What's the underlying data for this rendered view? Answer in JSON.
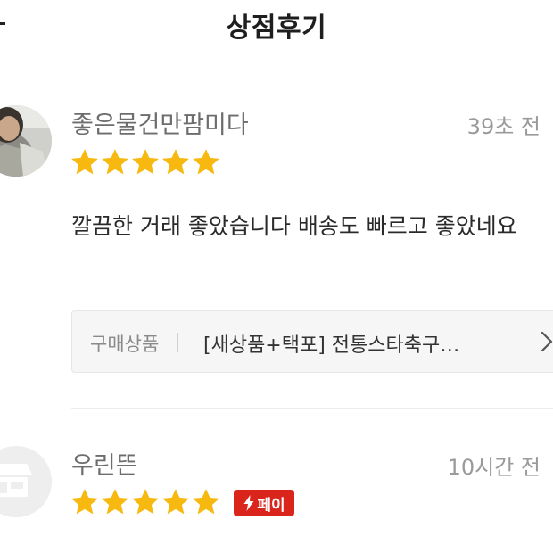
{
  "header": {
    "title": "상점후기"
  },
  "reviews": [
    {
      "nickname": "좋은물건만팜미다",
      "time": "39초 전",
      "rating": 5,
      "content": "깔끔한 거래 좋았습니다 배송도 빠르고 좋았네요",
      "product": {
        "label": "구매상품",
        "name": "[새상품+택포] 전통스타축구…"
      }
    },
    {
      "nickname": "우린뜬",
      "time": "10시간 전",
      "rating": 5,
      "badge": "페이"
    }
  ],
  "colors": {
    "star": "#f7b90f",
    "badge": "#d9251c"
  }
}
